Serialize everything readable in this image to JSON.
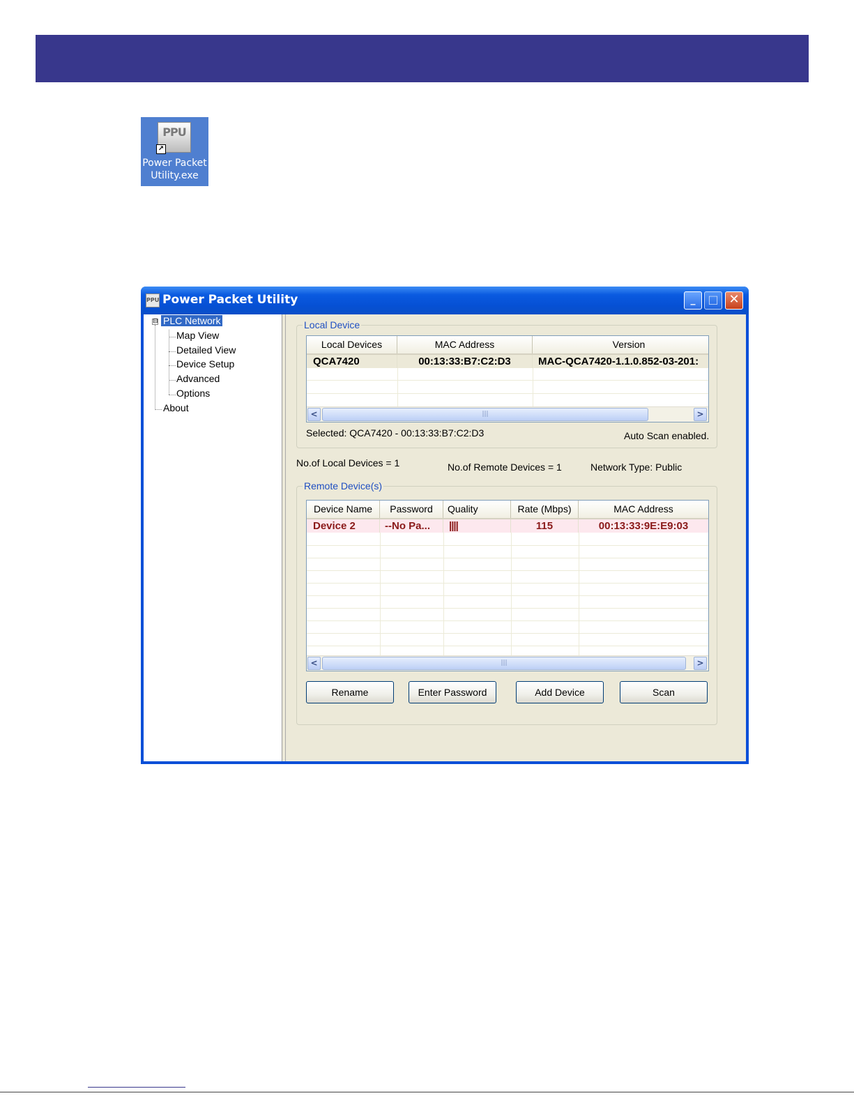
{
  "colors": {
    "banner": "#38378c",
    "title_bar": "#0a5ae0",
    "tree_selection": "#3169c6",
    "group_label": "#1f4fc2",
    "remote_row_text": "#8b1a1a"
  },
  "desktop_icon": {
    "icon": "ppu-app-icon",
    "glyph": "PPU",
    "shortcut_glyph": "↗",
    "label_line1": "Power Packet",
    "label_line2": "Utility.exe"
  },
  "window": {
    "title": "Power Packet Utility",
    "icon_glyph": "PPU",
    "minimize_glyph": "_",
    "maximize_glyph": "□",
    "close_glyph": "✕"
  },
  "tree": {
    "expander": "⊟",
    "root": "PLC Network",
    "children": [
      "Map View",
      "Detailed View",
      "Device Setup",
      "Advanced",
      "Options"
    ],
    "about": "About"
  },
  "local_device": {
    "group_label": "Local Device",
    "columns": [
      "Local Devices",
      "MAC Address",
      "Version"
    ],
    "rows": [
      {
        "name": "QCA7420",
        "mac": "00:13:33:B7:C2:D3",
        "version": "MAC-QCA7420-1.1.0.852-03-201:"
      }
    ],
    "scroll_thumb": "|||",
    "scroll_left": "<",
    "scroll_right": ">",
    "selected_text": "Selected: QCA7420 - 00:13:33:B7:C2:D3",
    "auto_scan_text": "Auto Scan enabled."
  },
  "stats": {
    "local_count": "No.of Local Devices = 1",
    "remote_count": "No.of Remote Devices = 1",
    "network_type": "Network Type: Public"
  },
  "remote_devices": {
    "group_label": "Remote Device(s)",
    "columns": [
      "Device Name",
      "Password",
      "Quality",
      "Rate (Mbps)",
      "MAC Address"
    ],
    "rows": [
      {
        "name": "Device 2",
        "password": "--No Pa...",
        "quality": "||||",
        "rate": "115",
        "mac": "00:13:33:9E:E9:03"
      }
    ],
    "scroll_thumb": "|||",
    "scroll_left": "<",
    "scroll_right": ">"
  },
  "buttons": {
    "rename": "Rename",
    "enter_password": "Enter Password",
    "add_device": "Add Device",
    "scan": "Scan"
  }
}
